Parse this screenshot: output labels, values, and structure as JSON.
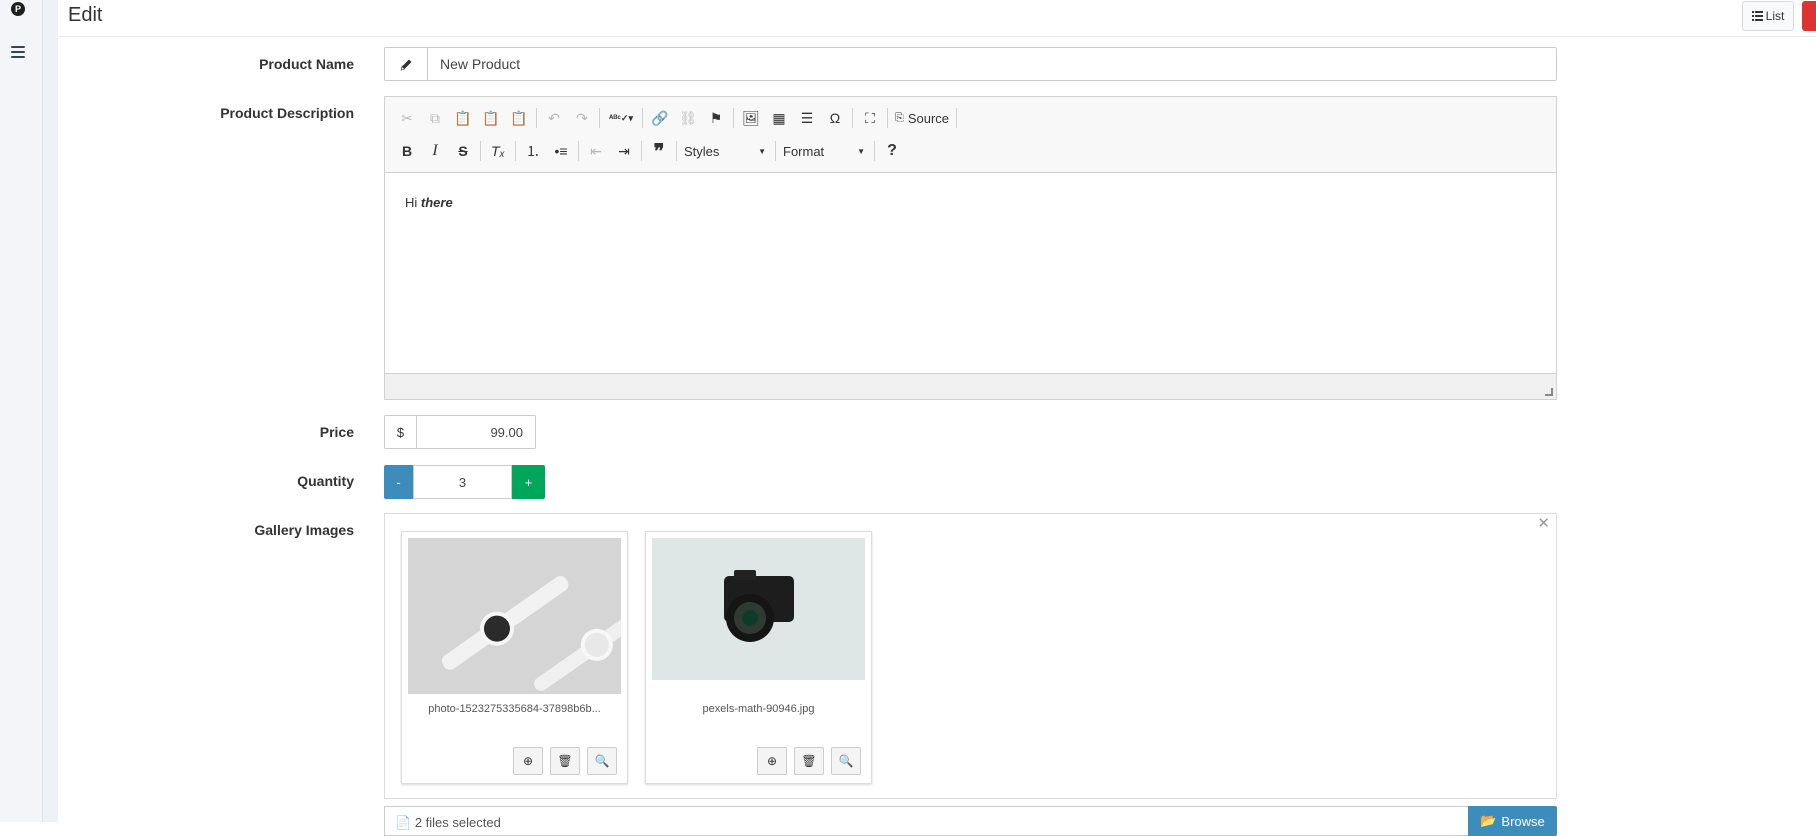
{
  "header": {
    "title": "Edit",
    "list_button": "List"
  },
  "rail": {
    "logo_letter": "P"
  },
  "labels": {
    "product_name": "Product Name",
    "product_description": "Product Description",
    "price": "Price",
    "quantity": "Quantity",
    "gallery_images": "Gallery Images"
  },
  "product_name": {
    "value": "New Product"
  },
  "editor": {
    "source_label": "Source",
    "styles_label": "Styles",
    "format_label": "Format",
    "content_plain": "Hi ",
    "content_emphasis": "there"
  },
  "price": {
    "currency": "$",
    "value": "99.00"
  },
  "quantity": {
    "minus": "-",
    "value": "3",
    "plus": "+"
  },
  "gallery": {
    "items": [
      {
        "filename": "photo-1523275335684-37898b6b..."
      },
      {
        "filename": "pexels-math-90946.jpg"
      }
    ]
  },
  "file_picker": {
    "status": "2 files selected",
    "browse_label": "Browse"
  }
}
